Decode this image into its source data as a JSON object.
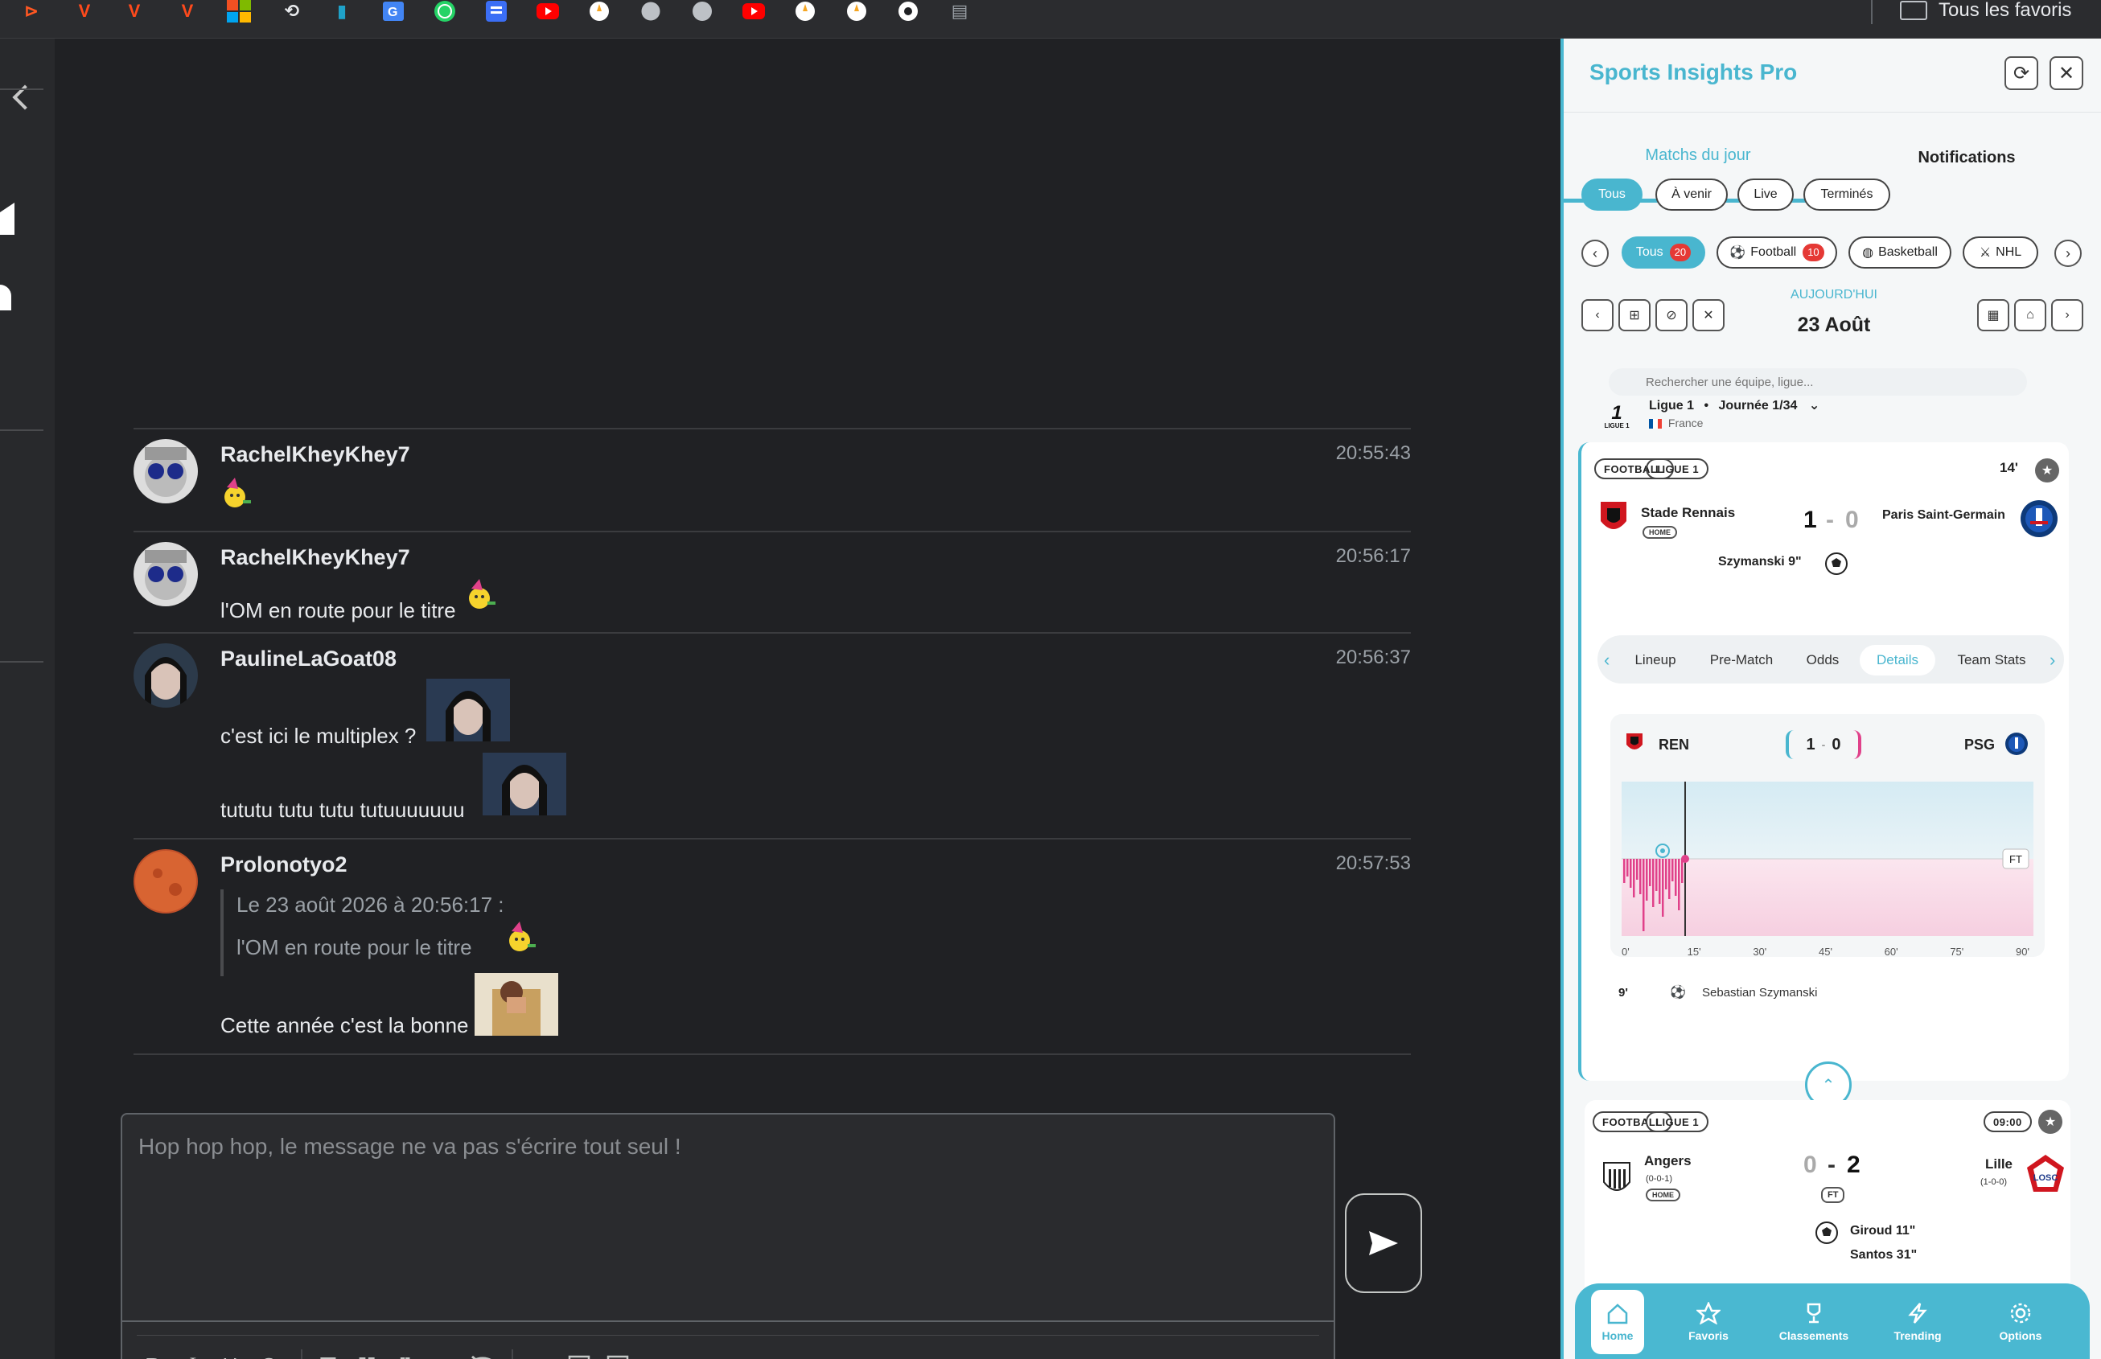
{
  "browser": {
    "favorites_label": "Tous les favoris"
  },
  "chat": {
    "messages": [
      {
        "user": "RachelKheyKhey7",
        "time": "20:55:43",
        "text": ""
      },
      {
        "user": "RachelKheyKhey7",
        "time": "20:56:17",
        "text": "l'OM en route pour le titre"
      },
      {
        "user": "PaulineLaGoat08",
        "time": "20:56:37",
        "lines": [
          "c'est ici le multiplex ?",
          "tututu tutu tutu tutuuuuuuu"
        ]
      },
      {
        "user": "Prolonotyo2",
        "time": "20:57:53",
        "quote_header": "Le 23 août 2026 à 20:56:17 :",
        "quote_text": "l'OM en route pour le titre",
        "text": "Cette année c'est la bonne"
      }
    ],
    "composer": {
      "placeholder": "Hop hop hop, le message ne va pas s'écrire tout seul !"
    },
    "toolbar": [
      "bold-icon",
      "italic-icon",
      "underline-icon",
      "strikethrough-icon",
      "bullet-list-icon",
      "numbered-list-icon",
      "quote-icon",
      "code-icon",
      "spoiler-icon",
      "emoji-icon",
      "image-icon",
      "video-icon"
    ]
  },
  "panel": {
    "title": "Sports Insights Pro",
    "tabs": [
      "Matchs du jour",
      "Notifications"
    ],
    "status_filters": [
      "Tous",
      "À venir",
      "Live",
      "Terminés"
    ],
    "sport_filters": [
      {
        "label": "Tous",
        "count": "20"
      },
      {
        "label": "Football",
        "count": "10"
      },
      {
        "label": "Basketball"
      },
      {
        "label": "NHL"
      }
    ],
    "date": {
      "caption": "AUJOURD'HUI",
      "value": "23 Août"
    },
    "search_placeholder": "Rechercher une équipe, ligue...",
    "league": {
      "name": "Ligue 1",
      "round": "Journée 1/34",
      "country": "France",
      "logo_text": "LIGUE 1"
    },
    "match1": {
      "tags": [
        "FOOTBALL",
        "LIGUE 1"
      ],
      "minute": "14'",
      "home": "Stade Rennais",
      "home_tag": "HOME",
      "away": "Paris Saint-Germain",
      "home_score": "1",
      "away_score": "0",
      "sep": "-",
      "scorer": "Szymanski 9\"",
      "subtabs": [
        "Lineup",
        "Pre-Match",
        "Odds",
        "Details",
        "Team Stats"
      ],
      "momentum": {
        "home_abbr": "REN",
        "away_abbr": "PSG",
        "score_home": "1",
        "score_away": "0",
        "ft_label": "FT",
        "x_ticks": [
          "0'",
          "15'",
          "30'",
          "45'",
          "60'",
          "75'",
          "90'"
        ]
      },
      "event": {
        "minute": "9'",
        "player": "Sebastian Szymanski"
      }
    },
    "match2": {
      "tags": [
        "FOOTBALL",
        "LIGUE 1"
      ],
      "time": "09:00",
      "home": "Angers",
      "home_record": "(0-0-1)",
      "home_tag": "HOME",
      "away": "Lille",
      "away_record": "(1-0-0)",
      "home_score": "0",
      "away_score": "2",
      "sep": "-",
      "status": "FT",
      "scorers": [
        "Giroud 11\"",
        "Santos 31\""
      ]
    },
    "nav": [
      "Home",
      "Favoris",
      "Classements",
      "Trending",
      "Options"
    ]
  },
  "colors": {
    "accent": "#49b6cf",
    "badge": "#e53935",
    "momentum_home": "#e0418a"
  }
}
